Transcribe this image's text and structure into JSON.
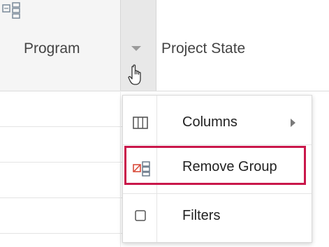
{
  "header": {
    "program_label": "Program",
    "project_state_label": "Project State"
  },
  "menu": {
    "items": [
      {
        "label": "Columns",
        "icon": "columns-icon",
        "has_submenu": true
      },
      {
        "label": "Remove Group",
        "icon": "remove-group-icon",
        "highlighted": true
      },
      {
        "label": "Filters",
        "icon": "filters-checkbox-icon"
      }
    ]
  },
  "colors": {
    "highlight": "#c9174a",
    "header_background": "#f5f5f5",
    "menu_button_background": "#e8e8e8",
    "remove_icon_red": "#d94b3a"
  }
}
